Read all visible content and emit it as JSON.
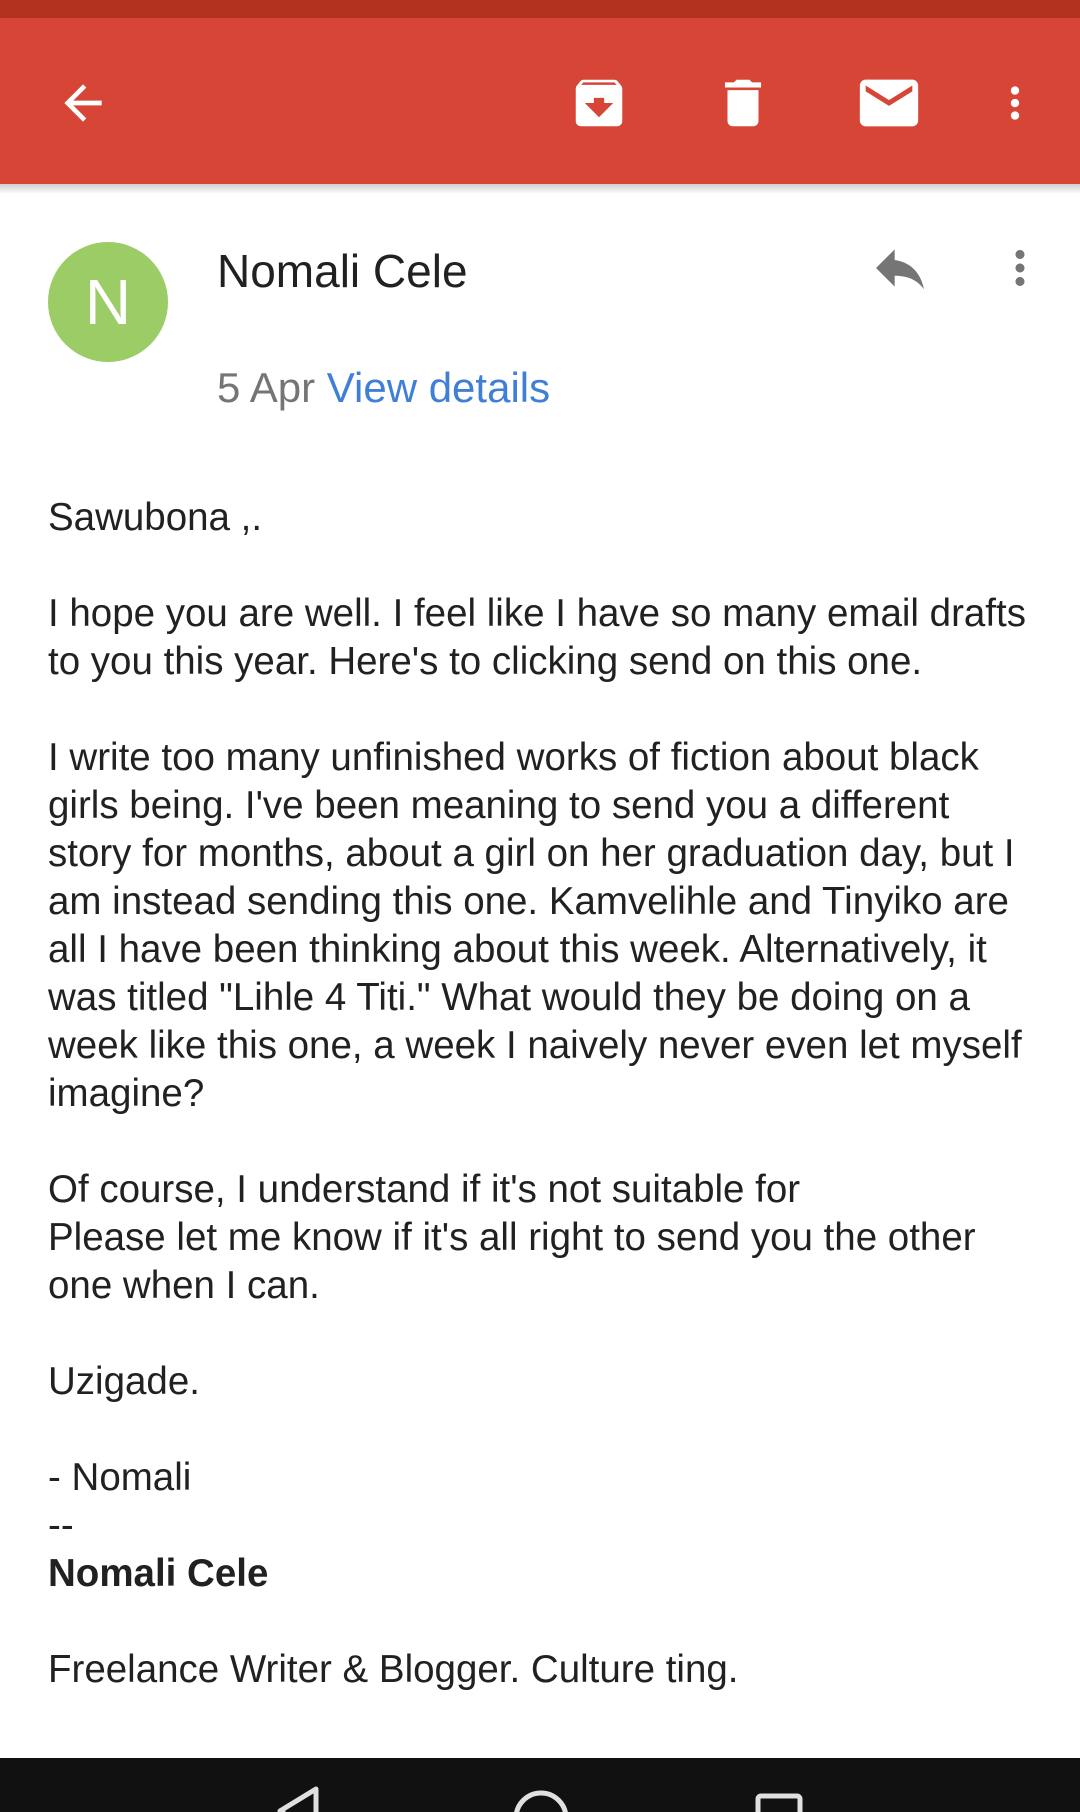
{
  "toolbar": {
    "icons": [
      "back-arrow-icon",
      "archive-icon",
      "trash-icon",
      "mark-unread-icon",
      "more-vert-icon"
    ],
    "color": "#d74536"
  },
  "message": {
    "avatar_letter": "N",
    "avatar_color": "#9ccc65",
    "sender": "Nomali Cele",
    "date": "5 Apr",
    "view_details": "View details",
    "link_color": "#3f7fd6"
  },
  "body": {
    "greeting": "Sawubona ,.",
    "para1": "I hope you are well. I feel like I have so many email drafts to you this year. Here's to clicking send on this one.",
    "para2": "I write too many unfinished works of fiction about black girls being. I've been meaning to send you a different story for months, about a girl on her graduation day, but I am instead sending this one. Kamvelihle and Tinyiko are all I have been thinking about this week. Alternatively, it was titled \"Lihle 4 Titi.\" What would they be doing on a week like this one, a week I naively never even let myself imagine?",
    "para3": "Of course, I understand if it's not suitable for\nPlease let me know if it's all right to send you the other one when I can.",
    "closing": "Uzigade.",
    "signoff": "- Nomali",
    "separator": "--",
    "sig_name": "Nomali Cele",
    "sig_title": "Freelance Writer & Blogger. Culture ting."
  }
}
